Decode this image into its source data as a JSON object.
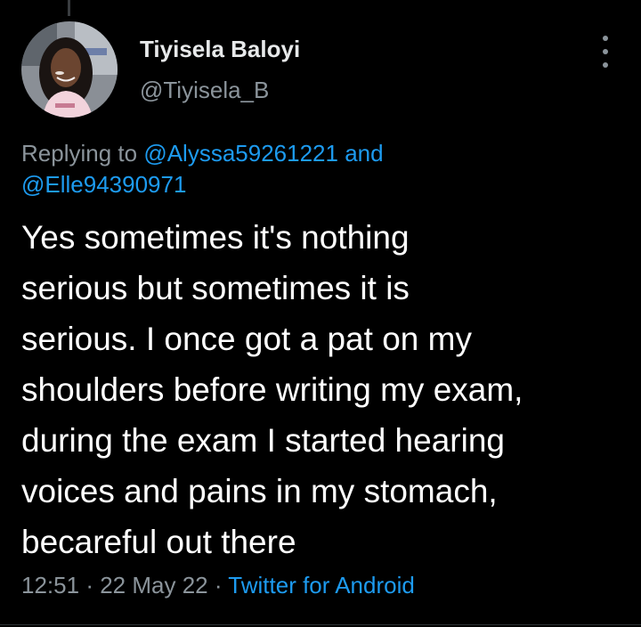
{
  "tweet": {
    "author": {
      "display_name": "Tiyisela Baloyi",
      "handle": "@Tiyisela_B"
    },
    "replying_to": {
      "prefix": "Replying to",
      "mention_1": "@Alyssa59261221",
      "conjunction": "and",
      "mention_2": "@Elle94390971"
    },
    "text_lines": [
      "Yes sometimes it's nothing",
      "serious but sometimes it is",
      "serious. I once got a pat on my",
      "shoulders before writing my exam,",
      "during the exam I started hearing",
      "voices and pains in my stomach,",
      "becareful out there"
    ],
    "meta": {
      "time": "12:51",
      "separator": "·",
      "date": "22 May 22",
      "source": "Twitter for Android"
    },
    "more_icon": "more-vertical-icon"
  },
  "colors": {
    "background": "#000000",
    "primary_text": "#e7e9ea",
    "secondary_text": "#8b949b",
    "link": "#1d9bf0"
  }
}
